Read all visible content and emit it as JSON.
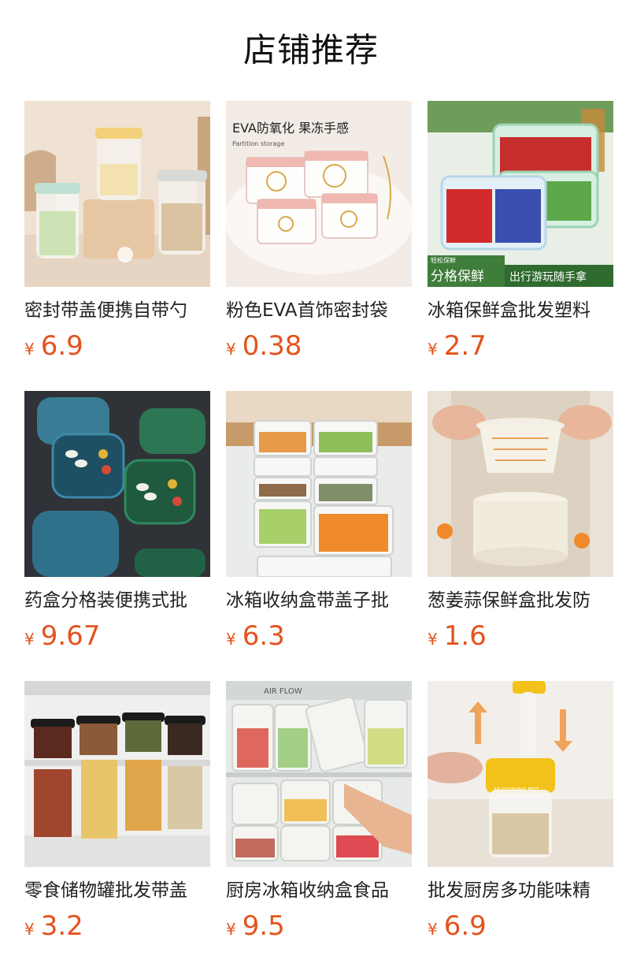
{
  "section_title": "店铺推荐",
  "currency_symbol": "¥",
  "products": [
    {
      "title": "密封带盖便携自带勺",
      "price": "6.9",
      "image": "overnight-oat-jars-image"
    },
    {
      "title": "粉色EVA首饰密封袋",
      "price": "0.38",
      "image": "jewelry-zip-bags-image",
      "image_text": {
        "headline": "EVA防氧化 果冻手感",
        "subline": "Partition storage"
      }
    },
    {
      "title": "冰箱保鲜盒批发塑料",
      "price": "2.7",
      "image": "fruit-crisper-boxes-image",
      "image_text": {
        "tag": "轻松保鲜",
        "left": "分格保鲜",
        "right": "出行游玩随手拿"
      }
    },
    {
      "title": "药盒分格装便携式批",
      "price": "9.67",
      "image": "pill-boxes-image"
    },
    {
      "title": "冰箱收纳盒带盖子批",
      "price": "6.3",
      "image": "fridge-storage-stack-image"
    },
    {
      "title": "葱姜蒜保鲜盒批发防",
      "price": "1.6",
      "image": "drain-basket-container-image"
    },
    {
      "title": "零食储物罐批发带盖",
      "price": "3.2",
      "image": "snack-canisters-image"
    },
    {
      "title": "厨房冰箱收纳盒食品",
      "price": "9.5",
      "image": "fridge-drawer-boxes-image",
      "image_text": {
        "brand": "AIR FLOW"
      }
    },
    {
      "title": "批发厨房多功能味精",
      "price": "6.9",
      "image": "seasoning-jar-image",
      "image_text": {
        "label": "SEASONING POT"
      }
    }
  ]
}
